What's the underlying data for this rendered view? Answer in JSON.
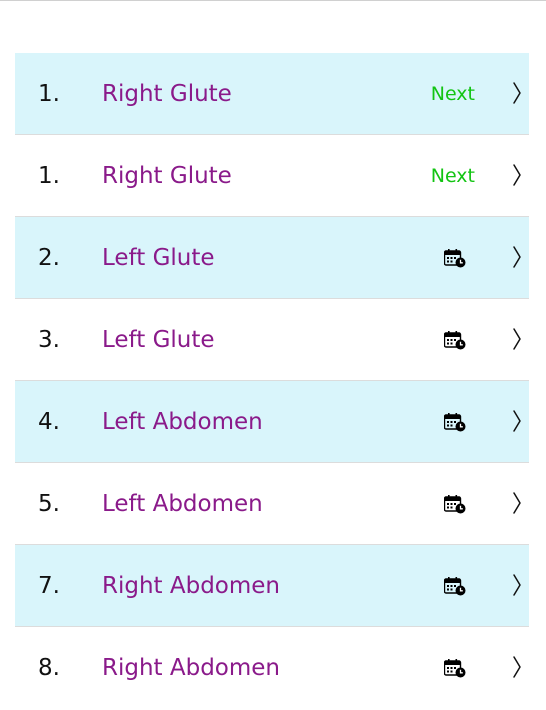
{
  "rows": [
    {
      "number": "1.",
      "site": "Right Glute",
      "status": "Next",
      "kind": "next",
      "highlight": true
    },
    {
      "number": "1.",
      "site": "Right Glute",
      "status": "Next",
      "kind": "next",
      "highlight": false
    },
    {
      "number": "2.",
      "site": "Left Glute",
      "status": "",
      "kind": "scheduled",
      "highlight": true
    },
    {
      "number": "3.",
      "site": "Left Glute",
      "status": "",
      "kind": "scheduled",
      "highlight": false
    },
    {
      "number": "4.",
      "site": "Left Abdomen",
      "status": "",
      "kind": "scheduled",
      "highlight": true
    },
    {
      "number": "5.",
      "site": "Left Abdomen",
      "status": "",
      "kind": "scheduled",
      "highlight": false
    },
    {
      "number": "7.",
      "site": "Right Abdomen",
      "status": "",
      "kind": "scheduled",
      "highlight": true
    },
    {
      "number": "8.",
      "site": "Right Abdomen",
      "status": "",
      "kind": "scheduled",
      "highlight": false
    }
  ],
  "icons": {
    "scheduled": "calendar-clock-icon",
    "disclosure": "chevron-right-icon"
  },
  "colors": {
    "highlight_row": "#d9f5fb",
    "site_text": "#8a1a8a",
    "next_text": "#13c413"
  }
}
